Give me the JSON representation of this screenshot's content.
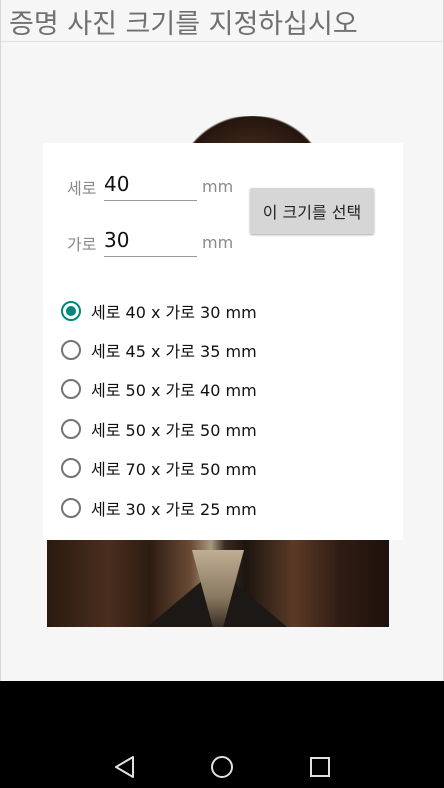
{
  "app": {
    "title": "증명 사진 크기를 지정하십시오"
  },
  "dialog": {
    "height_label": "세로",
    "height_value": "40",
    "width_label": "가로",
    "width_value": "30",
    "unit": "mm",
    "select_button": "이 크기를 선택",
    "options": [
      {
        "label": "세로 40 x 가로 30 mm",
        "checked": true
      },
      {
        "label": "세로 45 x 가로 35 mm",
        "checked": false
      },
      {
        "label": "세로 50 x 가로 40 mm",
        "checked": false
      },
      {
        "label": "세로 50 x 가로 50 mm",
        "checked": false
      },
      {
        "label": "세로 70 x 가로 50 mm",
        "checked": false
      },
      {
        "label": "세로 30 x 가로 25 mm",
        "checked": false
      }
    ]
  },
  "navbar": {
    "icons": [
      "back-icon",
      "home-icon",
      "recents-icon"
    ]
  },
  "colors": {
    "accent": "#00897b",
    "screen_bg": "#f6f6f6",
    "navbar_bg": "#000000"
  }
}
